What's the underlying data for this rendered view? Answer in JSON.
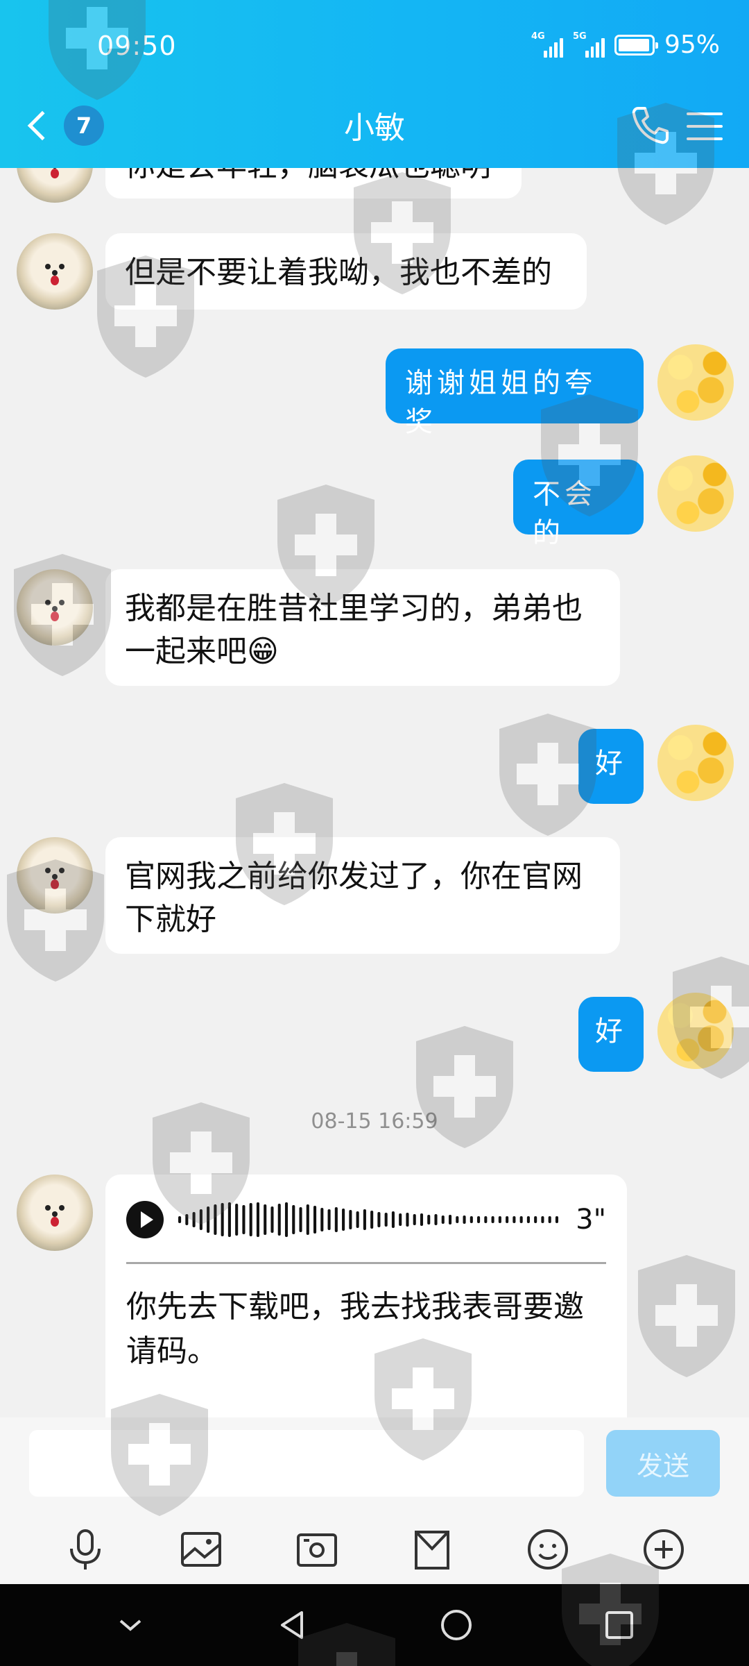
{
  "status_bar": {
    "time": "09:50",
    "network1": "4G",
    "network2": "5G",
    "battery": "95%"
  },
  "header": {
    "title": "小敏",
    "unread_count": "7",
    "back_icon": "chevron-left-icon",
    "call_icon": "phone-icon",
    "menu_icon": "hamburger-menu-icon"
  },
  "messages": [
    {
      "side": "left",
      "text": "你是会年轻，脑袋瓜也聪明"
    },
    {
      "side": "left",
      "text": "但是不要让着我呦，我也不差的"
    },
    {
      "side": "right",
      "text": "谢谢姐姐的夸奖"
    },
    {
      "side": "right",
      "text": "不会的"
    },
    {
      "side": "left",
      "text": "我都是在胜昔社里学习的，弟弟也一起来吧😁"
    },
    {
      "side": "right",
      "text": "好"
    },
    {
      "side": "left",
      "text": "官网我之前给你发过了，你在官网下就好"
    },
    {
      "side": "right",
      "text": "好"
    }
  ],
  "timestamp": "08-15 16:59",
  "voice_message": {
    "duration": "3\"",
    "transcript": "你先去下载吧，我去找我表哥要邀请码。"
  },
  "input": {
    "placeholder": "",
    "send_label": "发送"
  },
  "toolbar": [
    "microphone-icon",
    "image-icon",
    "camera-icon",
    "file-icon",
    "emoji-icon",
    "plus-icon"
  ],
  "system_nav": [
    "collapse-icon",
    "back-icon",
    "home-icon",
    "recents-icon"
  ],
  "colors": {
    "header": "#14b6f4",
    "outgoing_bubble": "#0b99f2",
    "send_button": "#92d3f8",
    "background": "#f1f1f1"
  }
}
